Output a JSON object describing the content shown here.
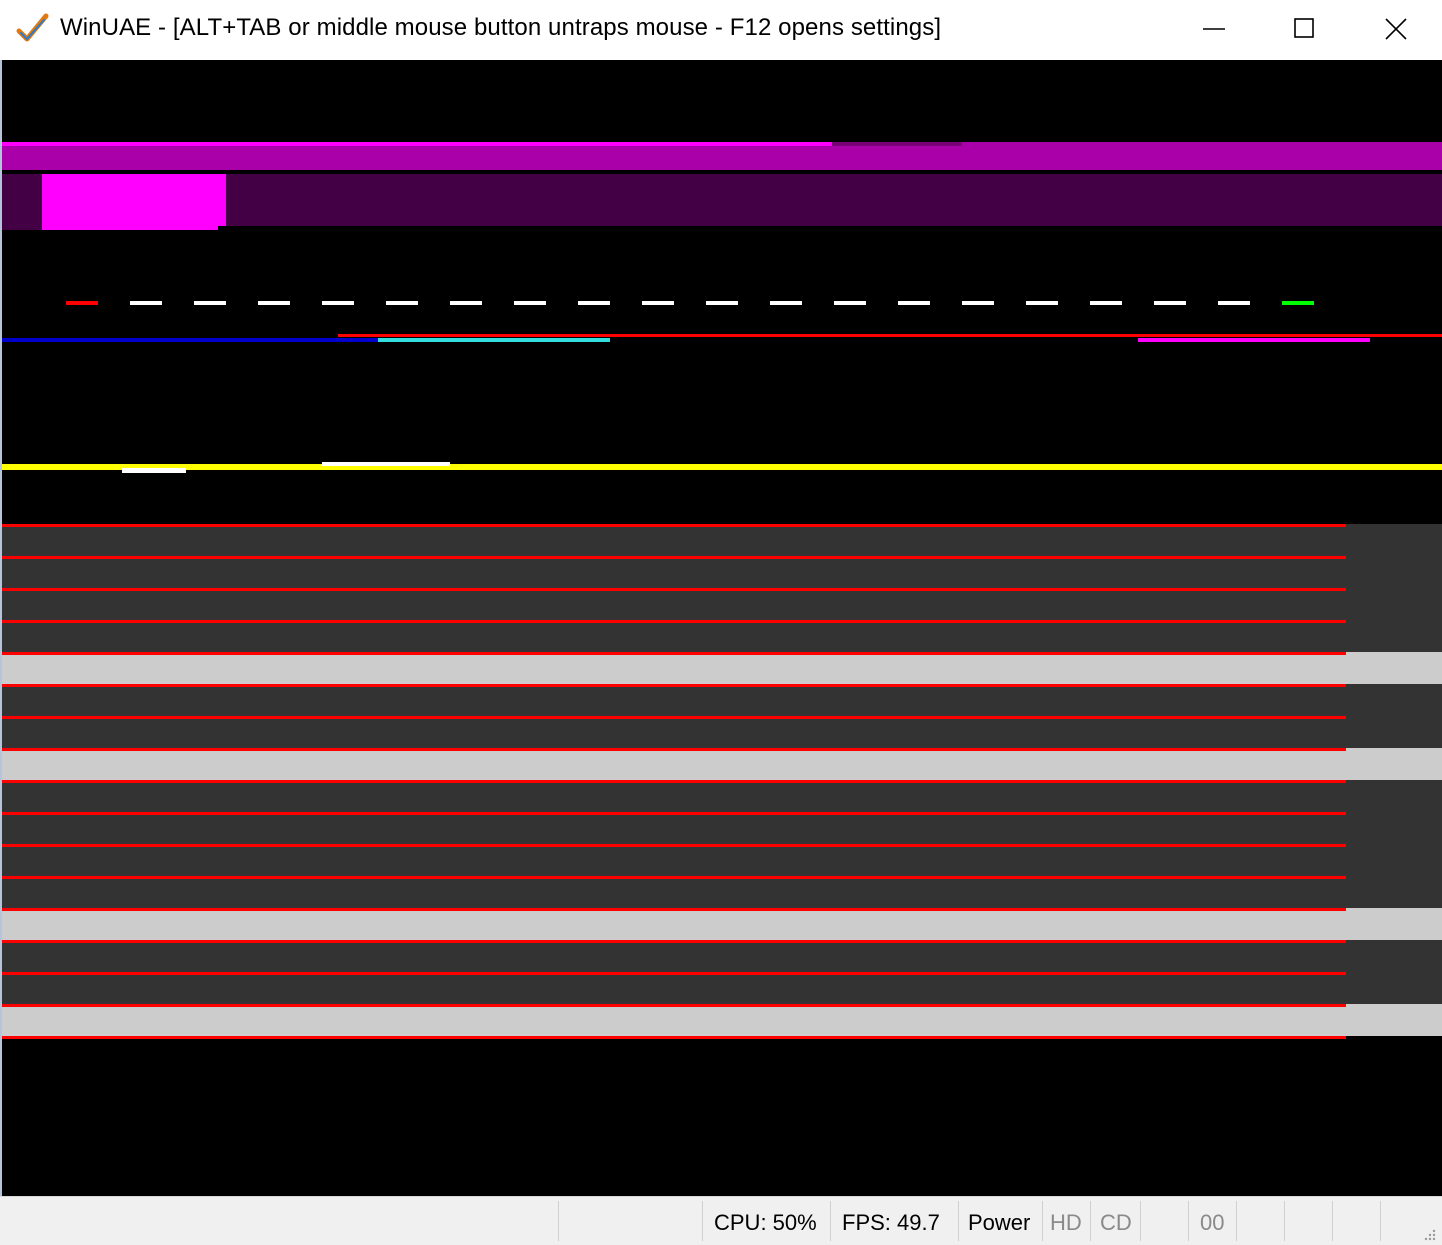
{
  "window": {
    "title": "WinUAE - [ALT+TAB or middle mouse button untraps mouse - F12 opens settings]",
    "app_icon": "winuae-checkmark-icon",
    "controls": {
      "minimize": "minimize-icon",
      "maximize": "maximize-icon",
      "close": "close-icon"
    }
  },
  "display": {
    "background": "#000000",
    "colors": {
      "magenta_bright": "#ff00ff",
      "magenta_mid": "#aa00aa",
      "magenta_dark": "#440044",
      "red": "#ff0000",
      "white": "#ffffff",
      "green": "#00ff00",
      "blue": "#0000cc",
      "cyan": "#33dddd",
      "yellow": "#ffff00",
      "grey_dark": "#333333",
      "grey_light": "#cccccc"
    }
  },
  "statusbar": {
    "cpu": "CPU: 50%",
    "fps": "FPS: 49.7",
    "power": "Power",
    "hd": "HD",
    "cd": "CD",
    "counter": "00"
  }
}
